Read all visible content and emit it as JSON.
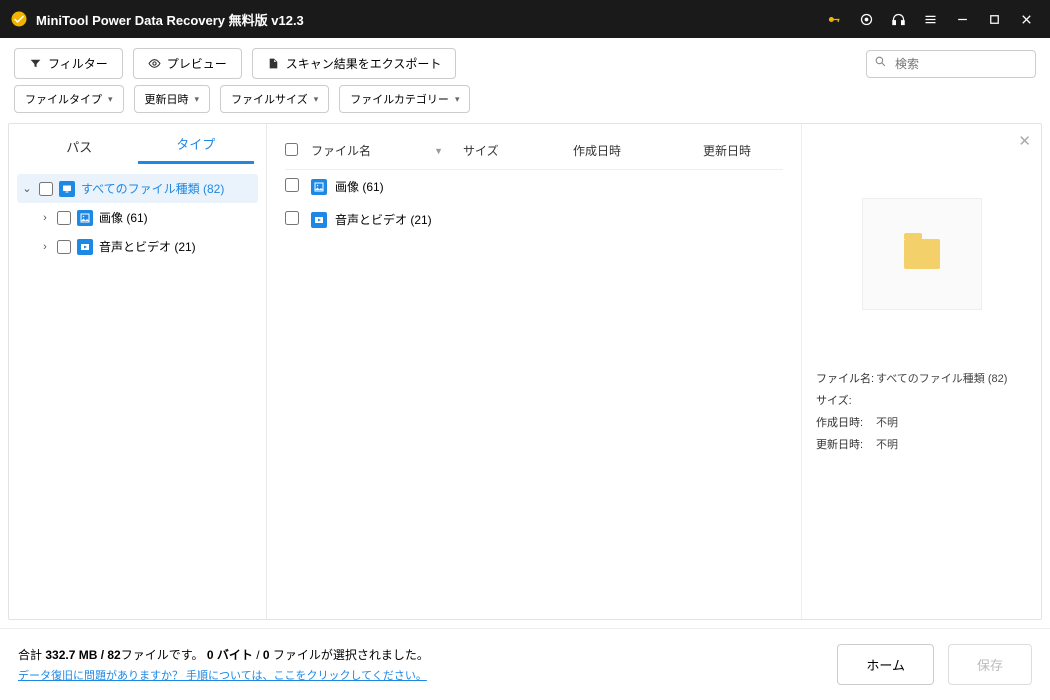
{
  "app": {
    "title": "MiniTool Power Data Recovery 無料版 v12.3"
  },
  "toolbar": {
    "filter": "フィルター",
    "preview": "プレビュー",
    "export": "スキャン結果をエクスポート",
    "search_placeholder": "検索"
  },
  "filters": {
    "file_type": "ファイルタイプ",
    "modified": "更新日時",
    "file_size": "ファイルサイズ",
    "category": "ファイルカテゴリー"
  },
  "tabs": {
    "path": "パス",
    "type": "タイプ"
  },
  "tree": {
    "all": "すべてのファイル種類 (82)",
    "images": "画像 (61)",
    "audio_video": "音声とビデオ (21)"
  },
  "columns": {
    "name": "ファイル名",
    "size": "サイズ",
    "created": "作成日時",
    "modified": "更新日時"
  },
  "rows": {
    "images": "画像 (61)",
    "audio_video": "音声とビデオ (21)"
  },
  "preview": {
    "filename_label": "ファイル名:",
    "filename_value": "すべてのファイル種類 (82)",
    "size_label": "サイズ:",
    "size_value": "",
    "created_label": "作成日時:",
    "created_value": "不明",
    "modified_label": "更新日時:",
    "modified_value": "不明"
  },
  "footer": {
    "summary_prefix": "合計 ",
    "summary_total": "332.7 MB / 82",
    "summary_mid1": "ファイルです。 ",
    "summary_bytes": "0 バイト",
    "summary_slash": " / ",
    "summary_count": "0",
    "summary_suffix": " ファイルが選択されました。",
    "help_link": "データ復旧に問題がありますか？ 手順については、ここをクリックしてください。",
    "home": "ホーム",
    "save": "保存"
  }
}
